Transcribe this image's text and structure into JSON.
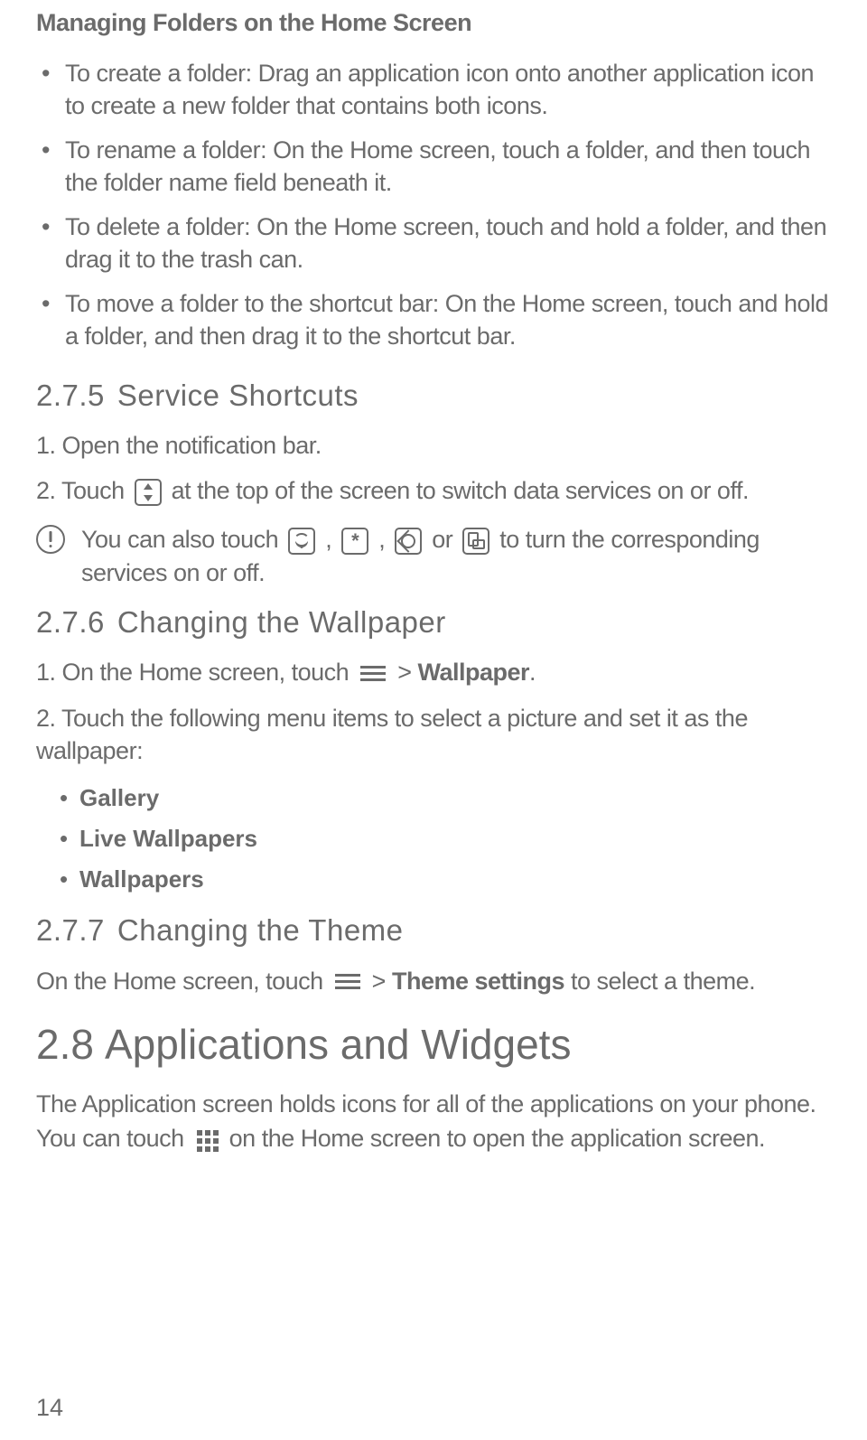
{
  "heading_folders": "Managing Folders on the Home Screen",
  "folder_bullets": [
    " To create a folder: Drag an application icon onto another application icon to create a new folder that contains both icons.",
    "To rename a folder: On the Home screen, touch a folder, and then touch the folder name field beneath it.",
    "To delete a folder: On the Home screen, touch and hold a folder, and then drag it to the trash can.",
    "To move a folder to the shortcut bar: On the Home screen, touch and hold a folder, and then drag it to the shortcut bar."
  ],
  "section_275_num": "2.7.5",
  "section_275_title": "Service Shortcuts",
  "step_275_1": "1. Open the notification bar.",
  "step_275_2a": "2. Touch ",
  "step_275_2b": " at the top of the screen to switch data services on or off.",
  "info_275_a": "You can also touch ",
  "info_275_b": " , ",
  "info_275_c": " , ",
  "info_275_d": " or ",
  "info_275_e": " to turn the corresponding services on or off.",
  "section_276_num": "2.7.6",
  "section_276_title": "Changing the Wallpaper",
  "step_276_1a": "1. On the Home screen, touch ",
  "step_276_1b": "   > ",
  "step_276_1c": "Wallpaper",
  "step_276_1d": ".",
  "step_276_2": "2. Touch the following menu items to select a picture and set it as the wallpaper:",
  "wallpaper_options": [
    "Gallery",
    "Live Wallpapers",
    "Wallpapers"
  ],
  "section_277_num": "2.7.7",
  "section_277_title": "Changing the Theme",
  "para_277_a": "On the Home screen, touch ",
  "para_277_b": "   > ",
  "para_277_c": "Theme settings",
  "para_277_d": " to select a theme.",
  "section_28_num": "2.8",
  "section_28_title": "Applications and Widgets",
  "para_28_a": " The Application screen holds icons for all of the applications on your phone. You can touch ",
  "para_28_b": " on the Home screen to open the application screen.",
  "page_number": "14"
}
